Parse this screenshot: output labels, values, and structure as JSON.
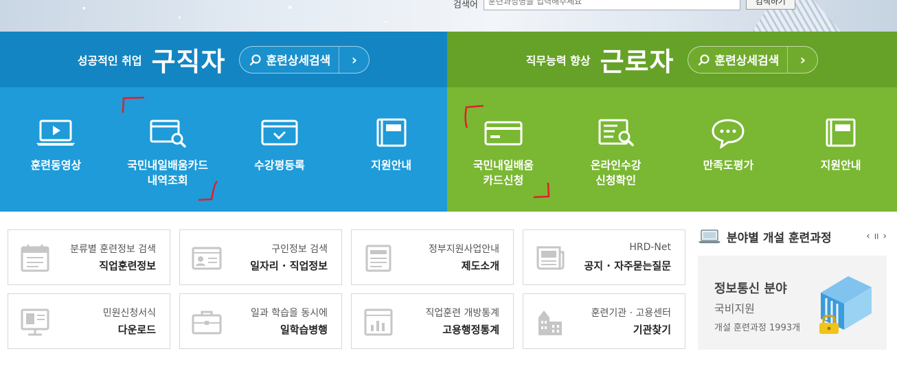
{
  "top": {
    "search_label": "검색어",
    "search_placeholder": "훈련과정명을 입력해주세요",
    "search_button": "검색하기"
  },
  "job_seeker": {
    "subtitle": "성공적인 취업",
    "title": "구직자",
    "search_label": "훈련상세검색",
    "items": [
      {
        "icon": "video-laptop-icon",
        "label": "훈련동영상"
      },
      {
        "icon": "card-search-icon",
        "label": "국민내일배움카드\n내역조회"
      },
      {
        "icon": "window-check-icon",
        "label": "수강평등록"
      },
      {
        "icon": "book-icon",
        "label": "지원안내"
      }
    ]
  },
  "worker": {
    "subtitle": "직무능력 향상",
    "title": "근로자",
    "search_label": "훈련상세검색",
    "items": [
      {
        "icon": "credit-card-icon",
        "label": "국민내일배움\n카드신청"
      },
      {
        "icon": "document-search-icon",
        "label": "온라인수강\n신청확인"
      },
      {
        "icon": "chat-bubble-icon",
        "label": "만족도평가"
      },
      {
        "icon": "book-icon",
        "label": "지원안내"
      }
    ]
  },
  "quick_links": [
    {
      "icon": "calendar-icon",
      "top": "분류별 훈련정보 검색",
      "main": "직업훈련정보"
    },
    {
      "icon": "id-card-icon",
      "top": "구인정보 검색",
      "main": "일자리 · 직업정보"
    },
    {
      "icon": "document-icon",
      "top": "정부지원사업안내",
      "main": "제도소개"
    },
    {
      "icon": "newspaper-icon",
      "top": "HRD-Net",
      "main": "공지 · 자주묻는질문"
    },
    {
      "icon": "monitor-download-icon",
      "top": "민원신청서식",
      "main": "다운로드"
    },
    {
      "icon": "briefcase-icon",
      "top": "일과 학습을 동시에",
      "main": "일학습병행"
    },
    {
      "icon": "stats-icon",
      "top": "직업훈련 개방통계",
      "main": "고용행정통계"
    },
    {
      "icon": "building-icon",
      "top": "훈련기관 · 고용센터",
      "main": "기관찾기"
    }
  ],
  "widget": {
    "title": "분야별 개설 훈련과정",
    "prev": "‹",
    "pause": "II",
    "next": "›",
    "card_title": "정보통신 분야",
    "card_sub": "국비지원",
    "card_count": "개설 훈련과정 1993개"
  },
  "colors": {
    "job_head": "#1385c2",
    "job_body": "#1e9bd8",
    "worker_head": "#66a128",
    "worker_body": "#7ab733"
  }
}
